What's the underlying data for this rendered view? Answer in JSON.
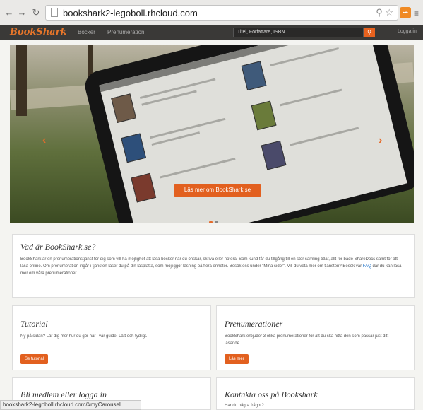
{
  "browser": {
    "back_icon": "back-arrow-icon",
    "forward_icon": "forward-arrow-icon",
    "reload_icon": "reload-icon",
    "url": "bookshark2-legoboll.rhcloud.com",
    "status_url": "bookshark2-legoboll.rhcloud.com/#myCarousel"
  },
  "site_nav": {
    "logo": "BookShark",
    "links": [
      "Böcker",
      "Prenumeration"
    ],
    "search_placeholder": "Titel, Författare, ISBN",
    "login": "Logga in"
  },
  "hero": {
    "cta_label": "Läs mer om BookShark.se",
    "prev_icon": "chevron-left-icon",
    "next_icon": "chevron-right-icon"
  },
  "about": {
    "title": "Vad är BookShark.se?",
    "body": "BookShark är en prenumerationstjänst för dig som vill ha möjlighet att läsa böcker när du önskar, skriva eller notera. Som kund får du tillgång till en stor samling titlar, allt för både ShareDocs samt för att läsa online. Om prenumeration ingår i tjänsten läser du på din läsplatta, som möjliggör läsning på flera enheter. Besök oss under \"Mina sidor\". Vill du veta mer om tjänsten? Besök vår",
    "link": "FAQ",
    "body_end": "där du kan läsa mer om våra prenumerationer."
  },
  "tutorial": {
    "title": "Tutorial",
    "body": "Ny på sidan? Lär dig mer hur du gör här i vår guide. Lätt och tydligt.",
    "button": "Se tutorial"
  },
  "subscriptions": {
    "title": "Prenumerationer",
    "body": "BookShark erbjuder 3 olika prenumerationer för att du ska hitta den som passar just ditt läsande.",
    "button": "Läs mer"
  },
  "member": {
    "title": "Bli medlem eller logga in"
  },
  "contact": {
    "title": "Kontakta oss på Bookshark",
    "body": "Har du några frågor?"
  }
}
